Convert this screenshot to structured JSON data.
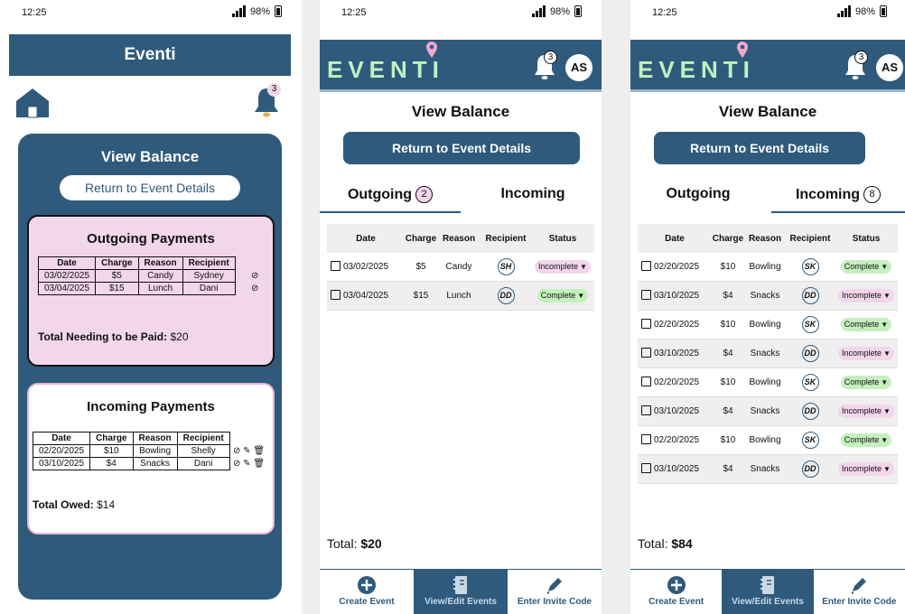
{
  "status_bar": {
    "time": "12:25",
    "battery": "98%"
  },
  "screen1": {
    "header_title": "Eventi",
    "notification_count": "3",
    "view_balance": "View Balance",
    "return_button": "Return to Event Details",
    "outgoing": {
      "title": "Outgoing Payments",
      "columns": [
        "Date",
        "Charge",
        "Reason",
        "Recipient"
      ],
      "rows": [
        [
          "03/02/2025",
          "$5",
          "Candy",
          "Sydney"
        ],
        [
          "03/04/2025",
          "$15",
          "Lunch",
          "Dani"
        ]
      ],
      "total_label": "Total Needing to be Paid:",
      "total_value": "$20"
    },
    "incoming": {
      "title": "Incoming Payments",
      "columns": [
        "Date",
        "Charge",
        "Reason",
        "Recipient"
      ],
      "rows": [
        [
          "02/20/2025",
          "$10",
          "Bowling",
          "Shelly"
        ],
        [
          "03/10/2025",
          "$4",
          "Snacks",
          "Dani"
        ]
      ],
      "total_label": "Total Owed:",
      "total_value": "$14"
    }
  },
  "app": {
    "logo": "EVENTI",
    "notification_count": "3",
    "avatar": "AS",
    "title": "View Balance",
    "return_button": "Return to Event Details",
    "columns": [
      "Date",
      "Charge",
      "Reason",
      "Recipient",
      "Status"
    ],
    "nav": [
      "Create Event",
      "View/Edit Events",
      "Enter Invite Code"
    ]
  },
  "screen2": {
    "tab_outgoing": "Outgoing",
    "tab_outgoing_count": "2",
    "tab_incoming": "Incoming",
    "rows": [
      {
        "date": "03/02/2025",
        "charge": "$5",
        "reason": "Candy",
        "recipient": "SH",
        "status": "Incomplete"
      },
      {
        "date": "03/04/2025",
        "charge": "$15",
        "reason": "Lunch",
        "recipient": "DD",
        "status": "Complete"
      }
    ],
    "total_label": "Total:",
    "total_value": "$20"
  },
  "screen3": {
    "tab_outgoing": "Outgoing",
    "tab_incoming": "Incoming",
    "tab_incoming_count": "8",
    "rows": [
      {
        "date": "02/20/2025",
        "charge": "$10",
        "reason": "Bowling",
        "recipient": "SK",
        "status": "Complete"
      },
      {
        "date": "03/10/2025",
        "charge": "$4",
        "reason": "Snacks",
        "recipient": "DD",
        "status": "Incomplete"
      },
      {
        "date": "02/20/2025",
        "charge": "$10",
        "reason": "Bowling",
        "recipient": "SK",
        "status": "Complete"
      },
      {
        "date": "03/10/2025",
        "charge": "$4",
        "reason": "Snacks",
        "recipient": "DD",
        "status": "Incomplete"
      },
      {
        "date": "02/20/2025",
        "charge": "$10",
        "reason": "Bowling",
        "recipient": "SK",
        "status": "Complete"
      },
      {
        "date": "03/10/2025",
        "charge": "$4",
        "reason": "Snacks",
        "recipient": "DD",
        "status": "Incomplete"
      },
      {
        "date": "02/20/2025",
        "charge": "$10",
        "reason": "Bowling",
        "recipient": "SK",
        "status": "Complete"
      },
      {
        "date": "03/10/2025",
        "charge": "$4",
        "reason": "Snacks",
        "recipient": "DD",
        "status": "Incomplete"
      }
    ],
    "total_label": "Total:",
    "total_value": "$84"
  },
  "colors": {
    "primary": "#2f5a7c",
    "complete": "#c5f0be",
    "incomplete": "#f2d6ea",
    "logo": "#c3f0c0"
  },
  "icons": [
    "home-icon",
    "bell-icon",
    "check-circle-icon",
    "edit-icon",
    "trash-icon",
    "location-pin-icon",
    "plus-circle-icon",
    "notebook-icon",
    "pen-icon",
    "signal-icon",
    "battery-icon",
    "dropdown-arrow-icon"
  ]
}
